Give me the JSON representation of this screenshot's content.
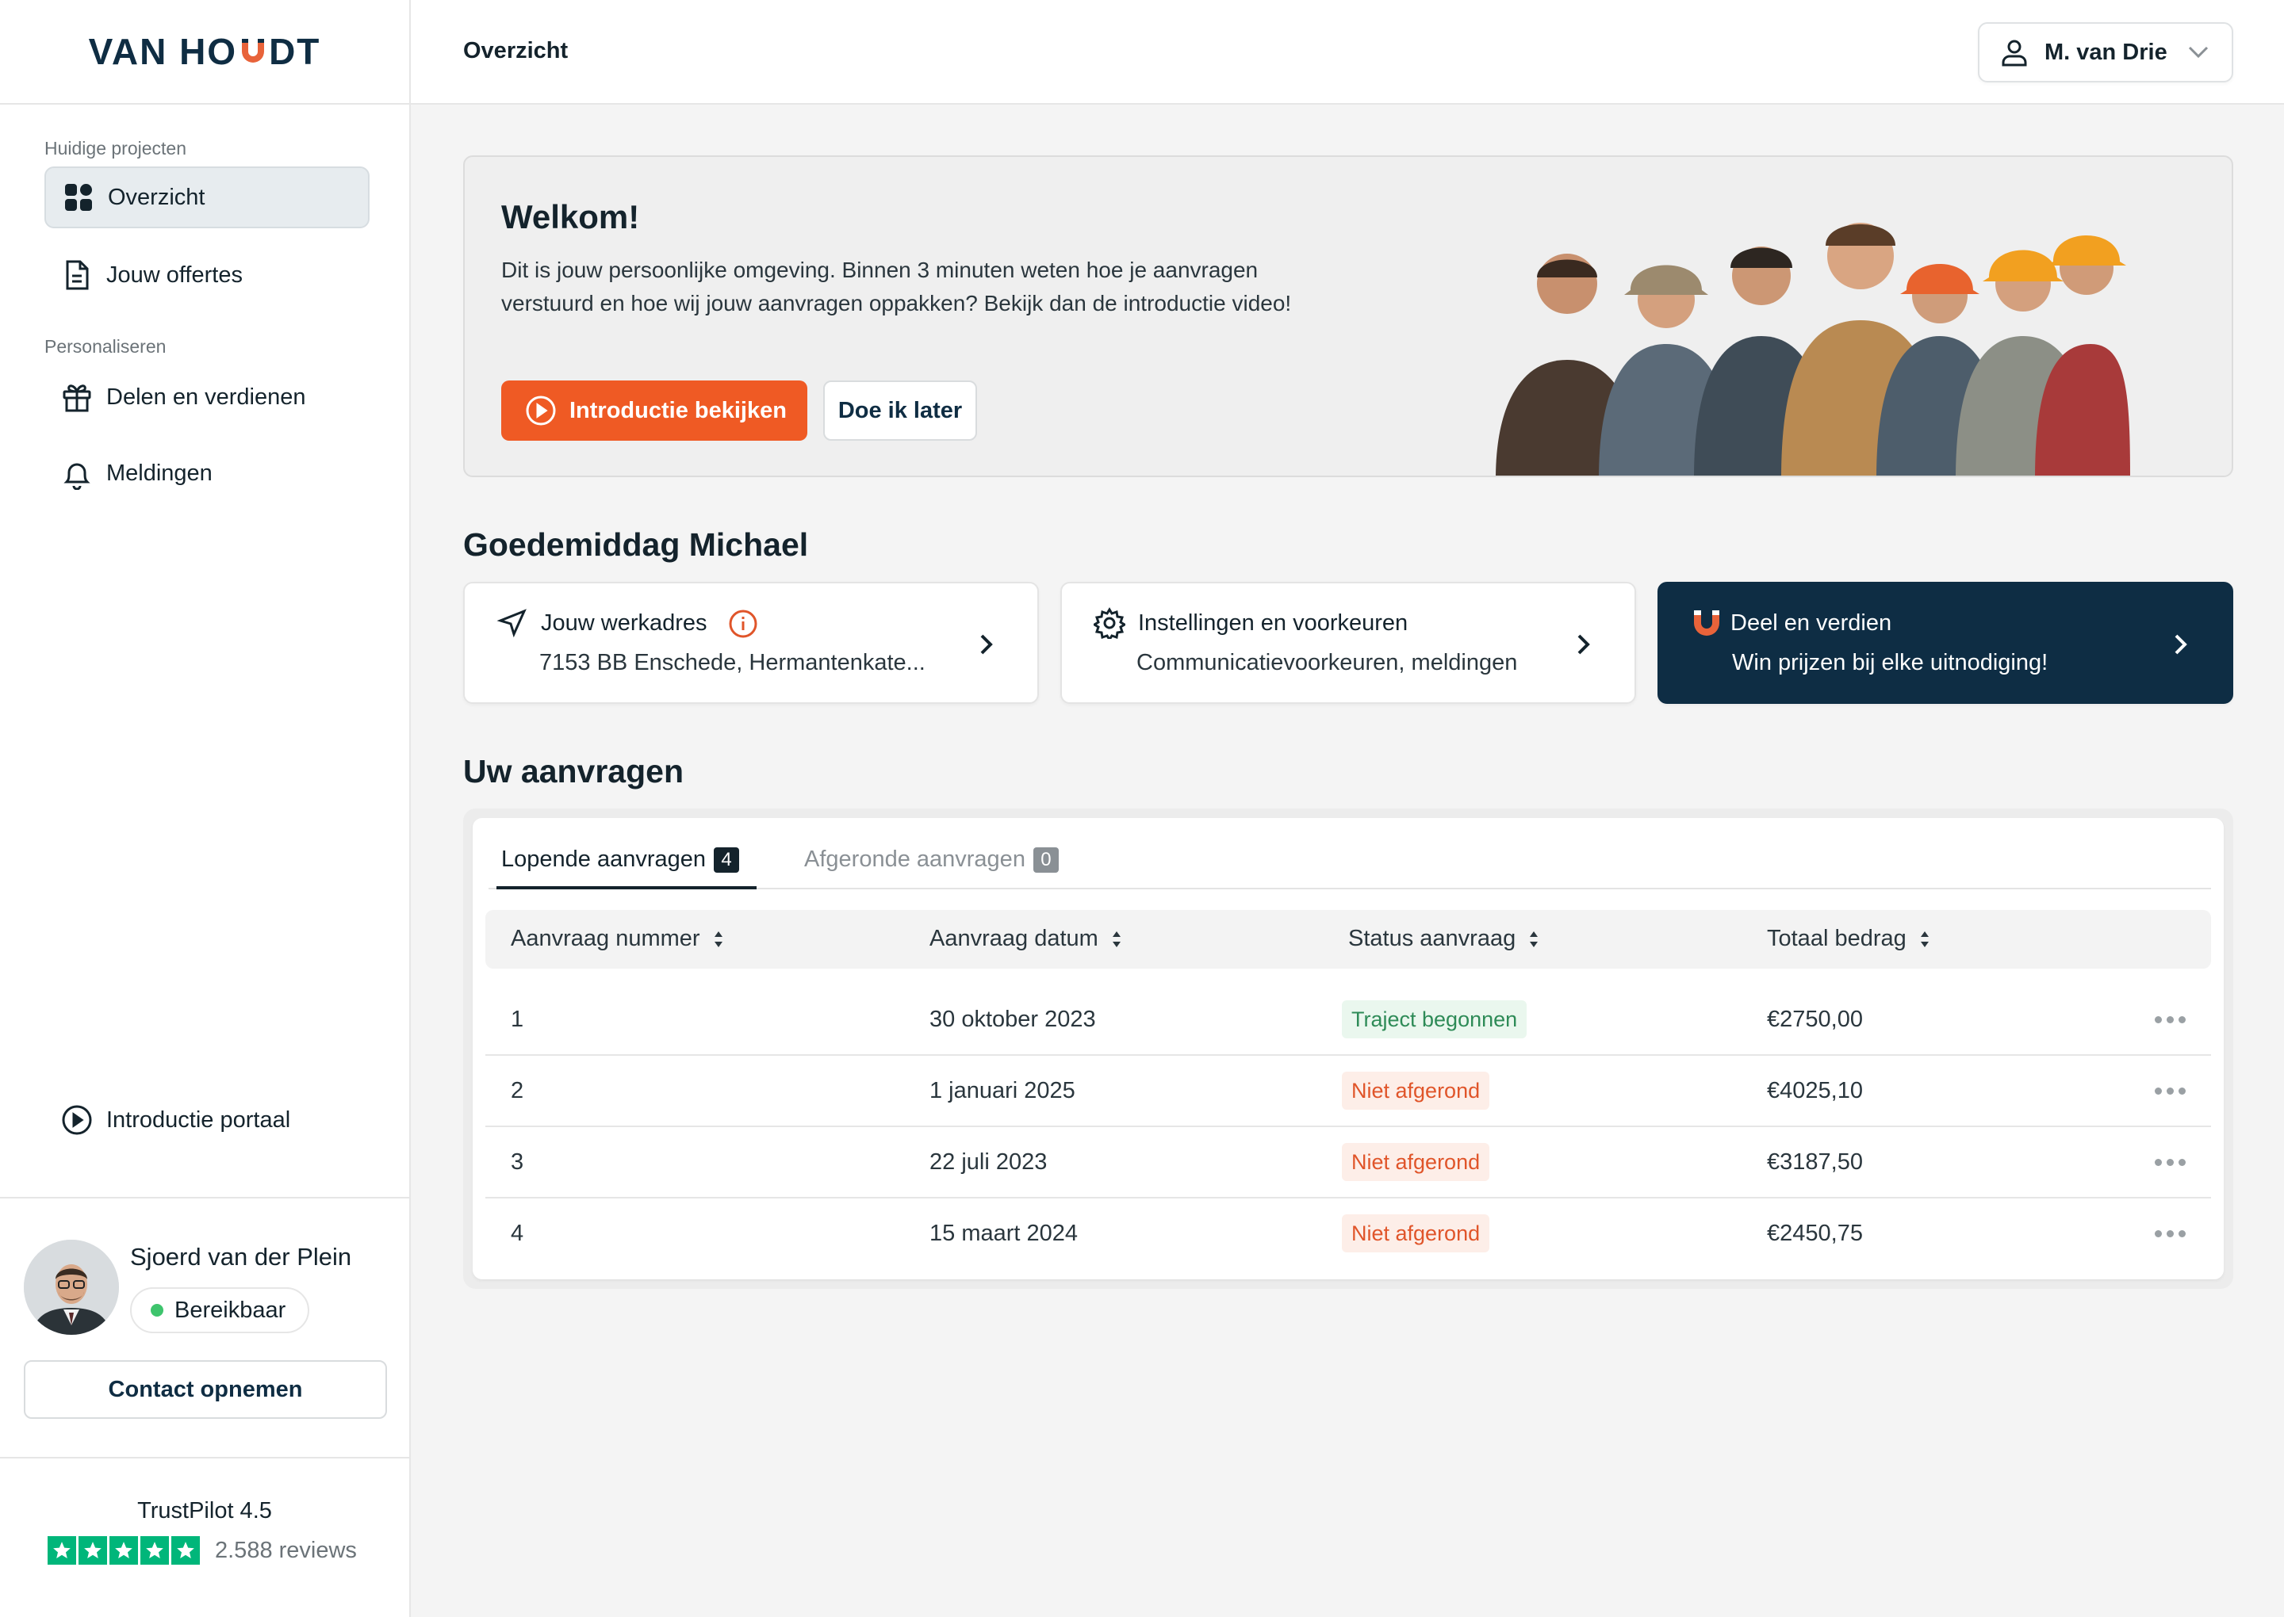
{
  "brand": {
    "logo_left": "VAN HO",
    "logo_right": "DT",
    "accent": "#ef5a24",
    "navy": "#0e2d44"
  },
  "sidebar": {
    "section_projects": "Huidige projecten",
    "section_personal": "Personaliseren",
    "items": [
      {
        "label": "Overzicht",
        "icon": "grid-icon",
        "active": true
      },
      {
        "label": "Jouw offertes",
        "icon": "document-icon"
      },
      {
        "label": "Delen en verdienen",
        "icon": "gift-icon"
      },
      {
        "label": "Meldingen",
        "icon": "bell-icon"
      },
      {
        "label": "Introductie portaal",
        "icon": "play-circle-icon"
      }
    ],
    "advisor": {
      "name": "Sjoerd van der Plein",
      "status": "Bereikbaar",
      "contact_label": "Contact opnemen"
    },
    "trustpilot": {
      "title": "TrustPilot 4.5",
      "stars": 5,
      "reviews": "2.588 reviews"
    }
  },
  "header": {
    "breadcrumb": "Overzicht",
    "user_name": "M. van Drie"
  },
  "welcome": {
    "title": "Welkom!",
    "text": "Dit is jouw persoonlijke omgeving. Binnen 3 minuten weten hoe je aanvragen verstuurd en hoe wij jouw aanvragen oppakken? Bekijk dan de introductie video!",
    "primary_label": "Introductie bekijken",
    "secondary_label": "Doe ik later"
  },
  "greeting": "Goedemiddag Michael",
  "cards": [
    {
      "title": "Jouw werkadres",
      "subtitle": "7153 BB Enschede, Hermantenkate...",
      "icon": "navigation-arrow-icon"
    },
    {
      "title": "Instellingen en voorkeuren",
      "subtitle": "Communicatievoorkeuren, meldingen",
      "icon": "gear-icon"
    },
    {
      "title": "Deel en verdien",
      "subtitle": "Win prijzen bij elke uitnodiging!",
      "icon": "magnet-icon"
    }
  ],
  "requests": {
    "title": "Uw aanvragen",
    "tabs": [
      {
        "label": "Lopende aanvragen",
        "count": "4"
      },
      {
        "label": "Afgeronde aanvragen",
        "count": "0"
      }
    ],
    "columns": [
      "Aanvraag nummer",
      "Aanvraag datum",
      "Status aanvraag",
      "Totaal bedrag"
    ],
    "rows": [
      {
        "number": "1",
        "date": "30 oktober 2023",
        "status": "Traject begonnen",
        "status_color": "green",
        "amount": "€2750,00"
      },
      {
        "number": "2",
        "date": "1 januari 2025",
        "status": "Niet afgerond",
        "status_color": "orange",
        "amount": "€4025,10"
      },
      {
        "number": "3",
        "date": "22 juli 2023",
        "status": "Niet afgerond",
        "status_color": "orange",
        "amount": "€3187,50"
      },
      {
        "number": "4",
        "date": "15 maart 2024",
        "status": "Niet afgerond",
        "status_color": "orange",
        "amount": "€2450,75"
      }
    ]
  }
}
